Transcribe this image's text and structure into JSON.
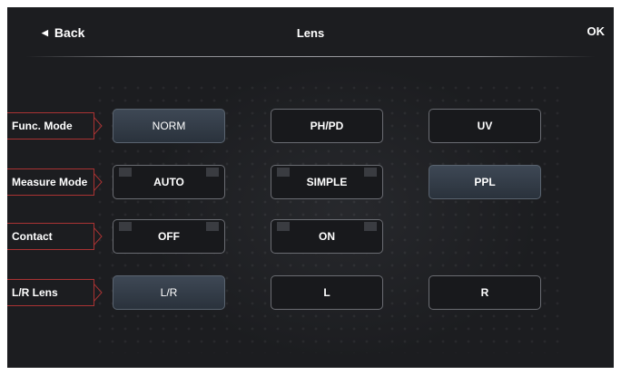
{
  "header": {
    "back_label": "Back",
    "title": "Lens",
    "ok_label": "OK"
  },
  "rows": [
    {
      "label": "Func. Mode",
      "options": [
        "NORM",
        "PH/PD",
        "UV"
      ],
      "selected": "NORM"
    },
    {
      "label": "Measure Mode",
      "options": [
        "AUTO",
        "SIMPLE",
        "PPL"
      ],
      "selected": "PPL"
    },
    {
      "label": "Contact",
      "options": [
        "OFF",
        "ON"
      ],
      "selected": "ON"
    },
    {
      "label": "L/R Lens",
      "options": [
        "L/R",
        "L",
        "R"
      ],
      "selected": "L/R"
    }
  ],
  "colors": {
    "background": "#1c1d20",
    "label_border": "#aa3333",
    "selected_button": "#37404b"
  },
  "icons": {
    "back": "triangle-left-icon"
  }
}
